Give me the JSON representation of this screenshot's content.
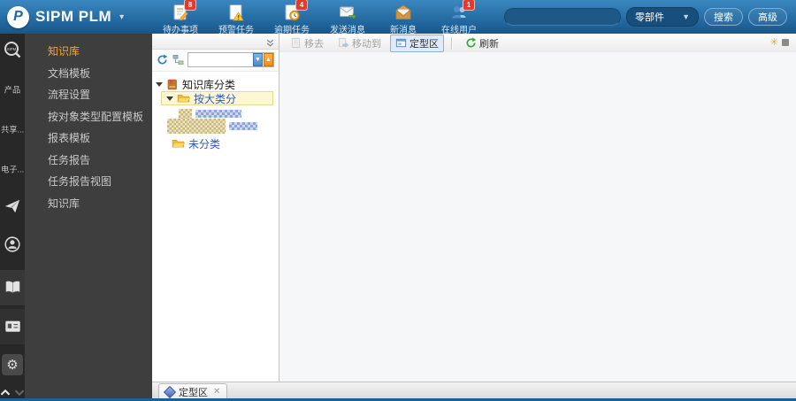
{
  "topbar": {
    "logo_glyph": "P",
    "logo_text": "SIPM PLM",
    "nav_items": [
      {
        "label": "待办事项",
        "badge": "8",
        "icon": "todo-tasks-icon"
      },
      {
        "label": "预警任务",
        "badge": "",
        "icon": "warning-tasks-icon"
      },
      {
        "label": "逾期任务",
        "badge": "4",
        "icon": "overdue-tasks-icon"
      },
      {
        "label": "发送消息",
        "badge": "",
        "icon": "send-message-icon"
      },
      {
        "label": "新消息",
        "badge": "",
        "icon": "new-message-icon"
      },
      {
        "label": "在线用户",
        "badge": "1",
        "icon": "online-users-icon"
      }
    ],
    "search": {
      "value": "",
      "placeholder": "",
      "category": "零部件",
      "search_label": "搜索",
      "advanced_label": "高级"
    }
  },
  "leftbar": {
    "product_label": "产品",
    "share_label": "共享...",
    "electronic_label": "电子..."
  },
  "sidebar": {
    "items": [
      {
        "label": "知识库",
        "active": true
      },
      {
        "label": "文档模板",
        "active": false
      },
      {
        "label": "流程设置",
        "active": false
      },
      {
        "label": "按对象类型配置模板",
        "active": false
      },
      {
        "label": "报表模板",
        "active": false
      },
      {
        "label": "任务报告",
        "active": false
      },
      {
        "label": "任务报告视图",
        "active": false
      },
      {
        "label": "知识库",
        "active": false
      }
    ]
  },
  "tree_panel": {
    "root_label": "知识库分类",
    "selected_node_label": "按大类分",
    "unclassified_label": "未分类",
    "redacted_item_count": 2
  },
  "main_toolbar": {
    "remove_label": "移去",
    "move_to_label": "移动到",
    "pinned_area_label": "定型区",
    "refresh_label": "刷新"
  },
  "bottom_tab": {
    "label": "定型区"
  },
  "colors": {
    "topbar_gradient_start": "#3a87c0",
    "topbar_gradient_end": "#16578d",
    "badge_red": "#e6392e",
    "active_menu_orange": "#f0a832",
    "tree_selected_bg": "#fdf8d3",
    "tree_selected_border": "#e7da8c",
    "link_blue": "#2b59c8",
    "bottom_border_blue": "#20608f"
  }
}
